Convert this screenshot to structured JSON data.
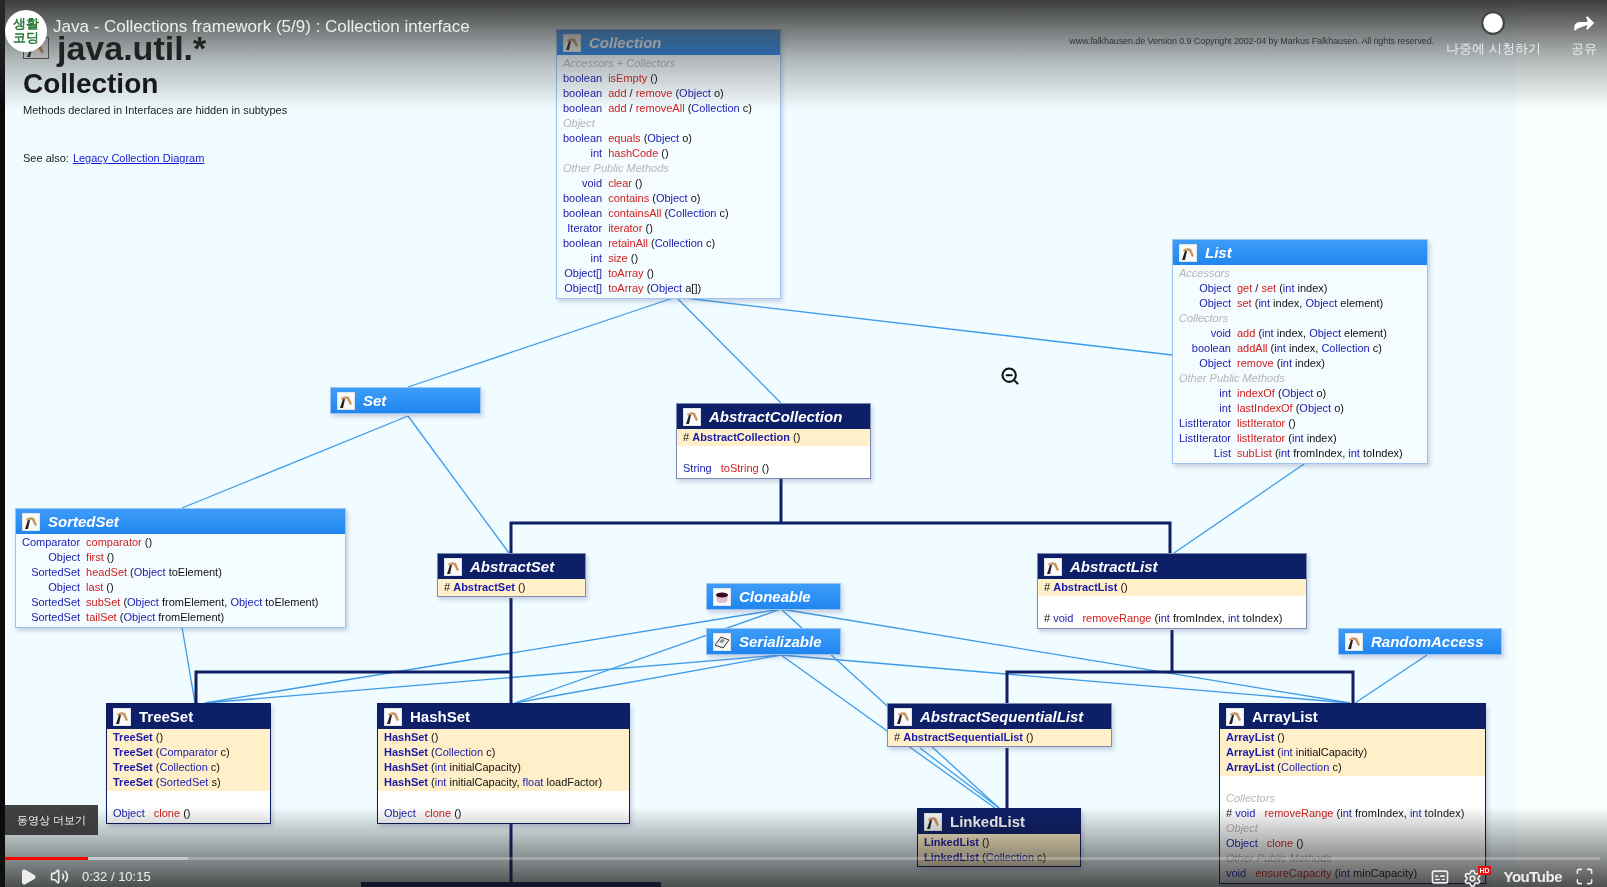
{
  "player": {
    "channel_logo": "생활코딩",
    "title": "Java - Collections framework (5/9) : Collection interface",
    "watch_later": "나중에 시청하기",
    "share": "공유",
    "more_videos": "동영상 더보기",
    "progress": {
      "level": 0.052
    },
    "buffer": {
      "level": 0.115
    },
    "time": "0:32 / 10:15",
    "hd_badge": "HD",
    "logo": "YouTube"
  },
  "page": {
    "package": "java.util.*",
    "heading": "Collection",
    "note": "Methods declared in Interfaces are hidden in subtypes",
    "see_also": "See also:",
    "see_also_link": "Legacy Collection Diagram",
    "copyright": "www.falkhausen.de Version 0.9 Copyright 2002-04 by Markus Falkhausen. All rights reserved."
  },
  "diagram": {
    "boxes": [
      {
        "name": "Collection",
        "kind": "interface",
        "members": [
          {
            "kind": "section",
            "text": "Accessors + Collectors"
          },
          {
            "kind": "member",
            "type": "boolean",
            "parts": [
              {
                "kind": "name",
                "text": "isEmpty"
              },
              {
                "kind": "plain",
                "text": " ()"
              }
            ]
          },
          {
            "kind": "member",
            "type": "boolean",
            "parts": [
              {
                "kind": "name",
                "text": "add"
              },
              {
                "kind": "plain",
                "text": " / "
              },
              {
                "kind": "name",
                "text": "remove"
              },
              {
                "kind": "plain",
                "text": " ("
              },
              {
                "kind": "type",
                "text": "Object"
              },
              {
                "kind": "plain",
                "text": " o)"
              }
            ]
          },
          {
            "kind": "member",
            "type": "boolean",
            "parts": [
              {
                "kind": "name",
                "text": "add"
              },
              {
                "kind": "plain",
                "text": " / "
              },
              {
                "kind": "name",
                "text": "removeAll"
              },
              {
                "kind": "plain",
                "text": " ("
              },
              {
                "kind": "type",
                "text": "Collection"
              },
              {
                "kind": "plain",
                "text": " c)"
              }
            ]
          },
          {
            "kind": "section",
            "text": "Object"
          },
          {
            "kind": "member",
            "type": "boolean",
            "parts": [
              {
                "kind": "name",
                "text": "equals"
              },
              {
                "kind": "plain",
                "text": " ("
              },
              {
                "kind": "type",
                "text": "Object"
              },
              {
                "kind": "plain",
                "text": " o)"
              }
            ]
          },
          {
            "kind": "member",
            "type": "int",
            "parts": [
              {
                "kind": "name",
                "text": "hashCode"
              },
              {
                "kind": "plain",
                "text": " ()"
              }
            ]
          },
          {
            "kind": "section",
            "text": "Other Public Methods"
          },
          {
            "kind": "member",
            "type": "void",
            "parts": [
              {
                "kind": "name",
                "text": "clear"
              },
              {
                "kind": "plain",
                "text": " ()"
              }
            ]
          },
          {
            "kind": "member",
            "type": "boolean",
            "parts": [
              {
                "kind": "name",
                "text": "contains"
              },
              {
                "kind": "plain",
                "text": " ("
              },
              {
                "kind": "type",
                "text": "Object"
              },
              {
                "kind": "plain",
                "text": " o)"
              }
            ]
          },
          {
            "kind": "member",
            "type": "boolean",
            "parts": [
              {
                "kind": "name",
                "text": "containsAll"
              },
              {
                "kind": "plain",
                "text": " ("
              },
              {
                "kind": "type",
                "text": "Collection"
              },
              {
                "kind": "plain",
                "text": " c)"
              }
            ]
          },
          {
            "kind": "member",
            "type": "Iterator",
            "parts": [
              {
                "kind": "name",
                "text": "iterator"
              },
              {
                "kind": "plain",
                "text": " ()"
              }
            ]
          },
          {
            "kind": "member",
            "type": "boolean",
            "parts": [
              {
                "kind": "name",
                "text": "retainAll"
              },
              {
                "kind": "plain",
                "text": " ("
              },
              {
                "kind": "type",
                "text": "Collection"
              },
              {
                "kind": "plain",
                "text": " c)"
              }
            ]
          },
          {
            "kind": "member",
            "type": "int",
            "parts": [
              {
                "kind": "name",
                "text": "size"
              },
              {
                "kind": "plain",
                "text": " ()"
              }
            ]
          },
          {
            "kind": "member",
            "type": "Object[]",
            "parts": [
              {
                "kind": "name",
                "text": "toArray"
              },
              {
                "kind": "plain",
                "text": " ()"
              }
            ]
          },
          {
            "kind": "member",
            "type": "Object[]",
            "parts": [
              {
                "kind": "name",
                "text": "toArray"
              },
              {
                "kind": "plain",
                "text": " ("
              },
              {
                "kind": "type",
                "text": "Object"
              },
              {
                "kind": "plain",
                "text": " a[])"
              }
            ]
          }
        ]
      },
      {
        "name": "List",
        "kind": "interface",
        "members": [
          {
            "kind": "section",
            "text": "Accessors"
          },
          {
            "kind": "member",
            "type": "Object",
            "parts": [
              {
                "kind": "name",
                "text": "get"
              },
              {
                "kind": "plain",
                "text": " / "
              },
              {
                "kind": "name",
                "text": "set"
              },
              {
                "kind": "plain",
                "text": " ("
              },
              {
                "kind": "type",
                "text": "int"
              },
              {
                "kind": "plain",
                "text": " index)"
              }
            ]
          },
          {
            "kind": "member",
            "type": "Object",
            "parts": [
              {
                "kind": "name",
                "text": "set"
              },
              {
                "kind": "plain",
                "text": " ("
              },
              {
                "kind": "type",
                "text": "int"
              },
              {
                "kind": "plain",
                "text": " index, "
              },
              {
                "kind": "type",
                "text": "Object"
              },
              {
                "kind": "plain",
                "text": " element)"
              }
            ]
          },
          {
            "kind": "section",
            "text": "Collectors"
          },
          {
            "kind": "member",
            "type": "void",
            "parts": [
              {
                "kind": "name",
                "text": "add"
              },
              {
                "kind": "plain",
                "text": " ("
              },
              {
                "kind": "type",
                "text": "int"
              },
              {
                "kind": "plain",
                "text": " index, "
              },
              {
                "kind": "type",
                "text": "Object"
              },
              {
                "kind": "plain",
                "text": " element)"
              }
            ]
          },
          {
            "kind": "member",
            "type": "boolean",
            "parts": [
              {
                "kind": "name",
                "text": "addAll"
              },
              {
                "kind": "plain",
                "text": " ("
              },
              {
                "kind": "type",
                "text": "int"
              },
              {
                "kind": "plain",
                "text": " index, "
              },
              {
                "kind": "type",
                "text": "Collection"
              },
              {
                "kind": "plain",
                "text": " c)"
              }
            ]
          },
          {
            "kind": "member",
            "type": "Object",
            "parts": [
              {
                "kind": "name",
                "text": "remove"
              },
              {
                "kind": "plain",
                "text": " ("
              },
              {
                "kind": "type",
                "text": "int"
              },
              {
                "kind": "plain",
                "text": " index)"
              }
            ]
          },
          {
            "kind": "section",
            "text": "Other Public Methods"
          },
          {
            "kind": "member",
            "type": "int",
            "parts": [
              {
                "kind": "name",
                "text": "indexOf"
              },
              {
                "kind": "plain",
                "text": " ("
              },
              {
                "kind": "type",
                "text": "Object"
              },
              {
                "kind": "plain",
                "text": " o)"
              }
            ]
          },
          {
            "kind": "member",
            "type": "int",
            "parts": [
              {
                "kind": "name",
                "text": "lastIndexOf"
              },
              {
                "kind": "plain",
                "text": " ("
              },
              {
                "kind": "type",
                "text": "Object"
              },
              {
                "kind": "plain",
                "text": " o)"
              }
            ]
          },
          {
            "kind": "member",
            "type": "ListIterator",
            "parts": [
              {
                "kind": "name",
                "text": "listIterator"
              },
              {
                "kind": "plain",
                "text": " ()"
              }
            ]
          },
          {
            "kind": "member",
            "type": "ListIterator",
            "parts": [
              {
                "kind": "name",
                "text": "listIterator"
              },
              {
                "kind": "plain",
                "text": " ("
              },
              {
                "kind": "type",
                "text": "int"
              },
              {
                "kind": "plain",
                "text": " index)"
              }
            ]
          },
          {
            "kind": "member",
            "type": "List",
            "parts": [
              {
                "kind": "name",
                "text": "subList"
              },
              {
                "kind": "plain",
                "text": " ("
              },
              {
                "kind": "type",
                "text": "int"
              },
              {
                "kind": "plain",
                "text": " fromIndex, "
              },
              {
                "kind": "type",
                "text": "int"
              },
              {
                "kind": "plain",
                "text": " toIndex)"
              }
            ]
          }
        ]
      },
      {
        "name": "Set",
        "kind": "interface"
      },
      {
        "name": "AbstractCollection",
        "kind": "abstract",
        "constructors": [
          [
            {
              "kind": "plain",
              "text": "# "
            },
            {
              "kind": "ctor",
              "text": "AbstractCollection"
            },
            {
              "kind": "plain",
              "text": " ()"
            }
          ]
        ],
        "members": [
          {
            "kind": "member",
            "parts": [
              {
                "kind": "rtype",
                "text": "String"
              },
              {
                "kind": "name",
                "text": "toString"
              },
              {
                "kind": "plain",
                "text": " ()"
              }
            ]
          }
        ]
      },
      {
        "name": "SortedSet",
        "kind": "interface",
        "members": [
          {
            "kind": "member",
            "type": "Comparator",
            "parts": [
              {
                "kind": "name",
                "text": "comparator"
              },
              {
                "kind": "plain",
                "text": " ()"
              }
            ]
          },
          {
            "kind": "member",
            "type": "Object",
            "parts": [
              {
                "kind": "name",
                "text": "first"
              },
              {
                "kind": "plain",
                "text": " ()"
              }
            ]
          },
          {
            "kind": "member",
            "type": "SortedSet",
            "parts": [
              {
                "kind": "name",
                "text": "headSet"
              },
              {
                "kind": "plain",
                "text": " ("
              },
              {
                "kind": "type",
                "text": "Object"
              },
              {
                "kind": "plain",
                "text": " toElement)"
              }
            ]
          },
          {
            "kind": "member",
            "type": "Object",
            "parts": [
              {
                "kind": "name",
                "text": "last"
              },
              {
                "kind": "plain",
                "text": " ()"
              }
            ]
          },
          {
            "kind": "member",
            "type": "SortedSet",
            "parts": [
              {
                "kind": "name",
                "text": "subSet"
              },
              {
                "kind": "plain",
                "text": " ("
              },
              {
                "kind": "type",
                "text": "Object"
              },
              {
                "kind": "plain",
                "text": " fromElement, "
              },
              {
                "kind": "type",
                "text": "Object"
              },
              {
                "kind": "plain",
                "text": " toElement)"
              }
            ]
          },
          {
            "kind": "member",
            "type": "SortedSet",
            "parts": [
              {
                "kind": "name",
                "text": "tailSet"
              },
              {
                "kind": "plain",
                "text": " ("
              },
              {
                "kind": "type",
                "text": "Object"
              },
              {
                "kind": "plain",
                "text": " fromElement)"
              }
            ]
          }
        ]
      },
      {
        "name": "AbstractSet",
        "kind": "abstract",
        "constructors": [
          [
            {
              "kind": "plain",
              "text": "# "
            },
            {
              "kind": "ctor",
              "text": "AbstractSet"
            },
            {
              "kind": "plain",
              "text": " ()"
            }
          ]
        ]
      },
      {
        "name": "Cloneable",
        "kind": "interface"
      },
      {
        "name": "Serializable",
        "kind": "interface"
      },
      {
        "name": "AbstractList",
        "kind": "abstract",
        "constructors": [
          [
            {
              "kind": "plain",
              "text": "# "
            },
            {
              "kind": "ctor",
              "text": "AbstractList"
            },
            {
              "kind": "plain",
              "text": " ()"
            }
          ]
        ],
        "members": [
          {
            "kind": "member",
            "parts": [
              {
                "kind": "plain",
                "text": "# "
              },
              {
                "kind": "rtype",
                "text": "void"
              },
              {
                "kind": "name",
                "text": "removeRange"
              },
              {
                "kind": "plain",
                "text": " ("
              },
              {
                "kind": "type",
                "text": "int"
              },
              {
                "kind": "plain",
                "text": " fromIndex, "
              },
              {
                "kind": "type",
                "text": "int"
              },
              {
                "kind": "plain",
                "text": " toIndex)"
              }
            ]
          }
        ]
      },
      {
        "name": "RandomAccess",
        "kind": "interface"
      },
      {
        "name": "TreeSet",
        "kind": "class",
        "constructors": [
          [
            {
              "kind": "ctor",
              "text": "TreeSet"
            },
            {
              "kind": "plain",
              "text": " ()"
            }
          ],
          [
            {
              "kind": "ctor",
              "text": "TreeSet"
            },
            {
              "kind": "plain",
              "text": " ("
            },
            {
              "kind": "type",
              "text": "Comparator"
            },
            {
              "kind": "plain",
              "text": " c)"
            }
          ],
          [
            {
              "kind": "ctor",
              "text": "TreeSet"
            },
            {
              "kind": "plain",
              "text": " ("
            },
            {
              "kind": "type",
              "text": "Collection"
            },
            {
              "kind": "plain",
              "text": " c)"
            }
          ],
          [
            {
              "kind": "ctor",
              "text": "TreeSet"
            },
            {
              "kind": "plain",
              "text": " ("
            },
            {
              "kind": "type",
              "text": "SortedSet"
            },
            {
              "kind": "plain",
              "text": " s)"
            }
          ]
        ],
        "members": [
          {
            "kind": "member",
            "parts": [
              {
                "kind": "rtype",
                "text": "Object"
              },
              {
                "kind": "name",
                "text": "clone"
              },
              {
                "kind": "plain",
                "text": " ()"
              }
            ]
          }
        ]
      },
      {
        "name": "HashSet",
        "kind": "class",
        "constructors": [
          [
            {
              "kind": "ctor",
              "text": "HashSet"
            },
            {
              "kind": "plain",
              "text": " ()"
            }
          ],
          [
            {
              "kind": "ctor",
              "text": "HashSet"
            },
            {
              "kind": "plain",
              "text": " ("
            },
            {
              "kind": "type",
              "text": "Collection"
            },
            {
              "kind": "plain",
              "text": " c)"
            }
          ],
          [
            {
              "kind": "ctor",
              "text": "HashSet"
            },
            {
              "kind": "plain",
              "text": " ("
            },
            {
              "kind": "type",
              "text": "int"
            },
            {
              "kind": "plain",
              "text": " initialCapacity)"
            }
          ],
          [
            {
              "kind": "ctor",
              "text": "HashSet"
            },
            {
              "kind": "plain",
              "text": " ("
            },
            {
              "kind": "type",
              "text": "int"
            },
            {
              "kind": "plain",
              "text": " initialCapacity, "
            },
            {
              "kind": "type",
              "text": "float"
            },
            {
              "kind": "plain",
              "text": " loadFactor)"
            }
          ]
        ],
        "members": [
          {
            "kind": "member",
            "parts": [
              {
                "kind": "rtype",
                "text": "Object"
              },
              {
                "kind": "name",
                "text": "clone"
              },
              {
                "kind": "plain",
                "text": " ()"
              }
            ]
          }
        ]
      },
      {
        "name": "AbstractSequentialList",
        "kind": "abstract",
        "constructors": [
          [
            {
              "kind": "plain",
              "text": "# "
            },
            {
              "kind": "ctor",
              "text": "AbstractSequentialList"
            },
            {
              "kind": "plain",
              "text": " ()"
            }
          ]
        ]
      },
      {
        "name": "ArrayList",
        "kind": "class",
        "constructors": [
          [
            {
              "kind": "ctor",
              "text": "ArrayList"
            },
            {
              "kind": "plain",
              "text": " ()"
            }
          ],
          [
            {
              "kind": "ctor",
              "text": "ArrayList"
            },
            {
              "kind": "plain",
              "text": " ("
            },
            {
              "kind": "type",
              "text": "int"
            },
            {
              "kind": "plain",
              "text": " initialCapacity)"
            }
          ],
          [
            {
              "kind": "ctor",
              "text": "ArrayList"
            },
            {
              "kind": "plain",
              "text": " ("
            },
            {
              "kind": "type",
              "text": "Collection"
            },
            {
              "kind": "plain",
              "text": " c)"
            }
          ]
        ],
        "members": [
          {
            "kind": "section",
            "text": "Collectors"
          },
          {
            "kind": "member",
            "parts": [
              {
                "kind": "plain",
                "text": "# "
              },
              {
                "kind": "rtype",
                "text": "void"
              },
              {
                "kind": "name",
                "text": "removeRange"
              },
              {
                "kind": "plain",
                "text": " ("
              },
              {
                "kind": "type",
                "text": "int"
              },
              {
                "kind": "plain",
                "text": " fromIndex, "
              },
              {
                "kind": "type",
                "text": "int"
              },
              {
                "kind": "plain",
                "text": " toIndex)"
              }
            ]
          },
          {
            "kind": "section",
            "text": "Object"
          },
          {
            "kind": "member",
            "parts": [
              {
                "kind": "rtype",
                "text": "Object"
              },
              {
                "kind": "name",
                "text": "clone"
              },
              {
                "kind": "plain",
                "text": " ()"
              }
            ]
          },
          {
            "kind": "section",
            "text": "Other Public Methods"
          },
          {
            "kind": "member",
            "parts": [
              {
                "kind": "rtype",
                "text": "void"
              },
              {
                "kind": "name",
                "text": "ensureCapacity"
              },
              {
                "kind": "plain",
                "text": " ("
              },
              {
                "kind": "type",
                "text": "int"
              },
              {
                "kind": "plain",
                "text": " minCapacity)"
              }
            ]
          }
        ]
      },
      {
        "name": "LinkedList",
        "kind": "class",
        "constructors": [
          [
            {
              "kind": "ctor",
              "text": "LinkedList"
            },
            {
              "kind": "plain",
              "text": " ()"
            }
          ],
          [
            {
              "kind": "ctor",
              "text": "LinkedList"
            },
            {
              "kind": "plain",
              "text": " ("
            },
            {
              "kind": "type",
              "text": "Collection"
            },
            {
              "kind": "plain",
              "text": " c)"
            }
          ]
        ]
      }
    ]
  }
}
